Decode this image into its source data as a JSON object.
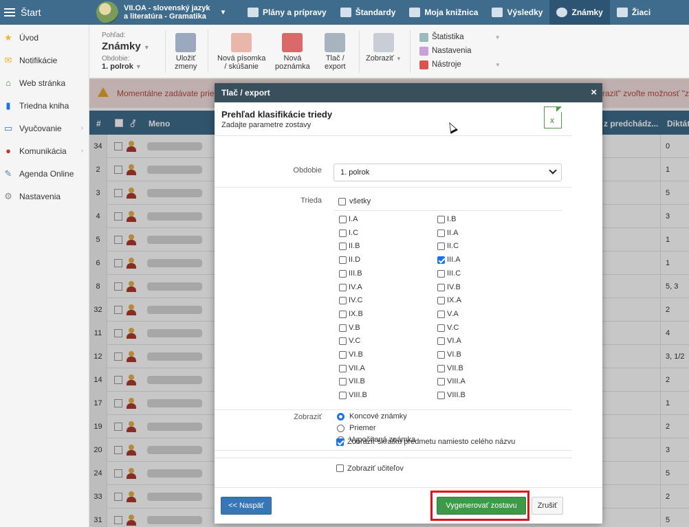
{
  "topbar": {
    "start_label": "Štart",
    "subject_line1": "VII.OA - slovenský jazyk",
    "subject_line2": "a literatúra - Gramatika",
    "nav": [
      {
        "label": "Plány a prípravy",
        "icon": "briefcase-icon"
      },
      {
        "label": "Štandardy",
        "icon": "shield-icon"
      },
      {
        "label": "Moja knižnica",
        "icon": "library-icon"
      },
      {
        "label": "Výsledky",
        "icon": "bar-chart-icon"
      },
      {
        "label": "Známky",
        "icon": "grades-icon",
        "active": true
      },
      {
        "label": "Žiaci",
        "icon": "students-icon"
      }
    ]
  },
  "sidebar": {
    "items": [
      {
        "label": "Úvod",
        "icon": "star-icon",
        "color": "#f0b429"
      },
      {
        "label": "Notifikácie",
        "icon": "envelope-icon",
        "color": "#f0b429"
      },
      {
        "label": "Web stránka",
        "icon": "home-icon",
        "color": "#2e8b57"
      },
      {
        "label": "Triedna kniha",
        "icon": "book-icon",
        "color": "#1a73e8"
      },
      {
        "label": "Vyučovanie",
        "icon": "open-book-icon",
        "color": "#3a6ea5",
        "submenu": true
      },
      {
        "label": "Komunikácia",
        "icon": "chat-icon",
        "color": "#c0392b",
        "submenu": true
      },
      {
        "label": "Agenda Online",
        "icon": "pen-icon",
        "color": "#4a7fb5"
      },
      {
        "label": "Nastavenia",
        "icon": "gear-icon",
        "color": "#888888"
      }
    ]
  },
  "toolbar": {
    "view_label": "Pohľad:",
    "view_value": "Známky",
    "period_label": "Obdobie:",
    "period_value": "1. polrok",
    "save_line1": "Uložiť",
    "save_line2": "zmeny",
    "new_test_line1": "Nová písomka",
    "new_test_line2": "/ skúšanie",
    "new_note_line1": "Nová",
    "new_note_line2": "poznámka",
    "print_line1": "Tlač /",
    "print_line2": "export",
    "show_label": "Zobraziť",
    "statistics_label": "Štatistika",
    "settings_label": "Nastavenia",
    "tools_label": "Nástroje"
  },
  "warning": {
    "text_left": "Momentálne zadávate priebe",
    "text_right": "razit\" zvoľte možnosť \"zn"
  },
  "table": {
    "headers": {
      "num": "#",
      "name": "Meno",
      "prev": "z predchádz...",
      "dictation": "Diktát"
    },
    "rows": [
      {
        "num": "34",
        "val": "0"
      },
      {
        "num": "2",
        "val": "1"
      },
      {
        "num": "3",
        "val": "5"
      },
      {
        "num": "4",
        "val": "3"
      },
      {
        "num": "5",
        "val": "1"
      },
      {
        "num": "6",
        "val": "1"
      },
      {
        "num": "8",
        "val": "5,  3"
      },
      {
        "num": "32",
        "val": "2"
      },
      {
        "num": "11",
        "val": "4"
      },
      {
        "num": "12",
        "val": "3,  1/2"
      },
      {
        "num": "14",
        "val": "2"
      },
      {
        "num": "17",
        "val": "1"
      },
      {
        "num": "19",
        "val": "2"
      },
      {
        "num": "20",
        "val": "3"
      },
      {
        "num": "24",
        "val": "5"
      },
      {
        "num": "33",
        "val": "2"
      },
      {
        "num": "31",
        "val": "5"
      }
    ]
  },
  "modal": {
    "header_title": "Tlač / export",
    "close_symbol": "×",
    "title": "Prehľad klasifikácie triedy",
    "subtitle": "Zadajte parametre zostavy",
    "excel_symbol": "x",
    "period_label": "Obdobie",
    "period_value": "1. polrok",
    "class_label": "Trieda",
    "all_label": "všetky",
    "classes": [
      {
        "label": "I.A",
        "checked": false
      },
      {
        "label": "I.B",
        "checked": false
      },
      {
        "label": "I.C",
        "checked": false
      },
      {
        "label": "II.A",
        "checked": false
      },
      {
        "label": "II.B",
        "checked": false
      },
      {
        "label": "II.C",
        "checked": false
      },
      {
        "label": "II.D",
        "checked": false
      },
      {
        "label": "III.A",
        "checked": true
      },
      {
        "label": "III.B",
        "checked": false
      },
      {
        "label": "III.C",
        "checked": false
      },
      {
        "label": "IV.A",
        "checked": false
      },
      {
        "label": "IV.B",
        "checked": false
      },
      {
        "label": "IV.C",
        "checked": false
      },
      {
        "label": "IX.A",
        "checked": false
      },
      {
        "label": "IX.B",
        "checked": false
      },
      {
        "label": "V.A",
        "checked": false
      },
      {
        "label": "V.B",
        "checked": false
      },
      {
        "label": "V.C",
        "checked": false
      },
      {
        "label": "V.C",
        "checked": false
      },
      {
        "label": "VI.A",
        "checked": false
      },
      {
        "label": "VI.B",
        "checked": false
      },
      {
        "label": "VI.B",
        "checked": false
      },
      {
        "label": "VII.A",
        "checked": false
      },
      {
        "label": "VII.B",
        "checked": false
      },
      {
        "label": "VII.B",
        "checked": false
      },
      {
        "label": "VIII.A",
        "checked": false
      },
      {
        "label": "VIII.B",
        "checked": false
      },
      {
        "label": "VIII.B",
        "checked": false
      }
    ],
    "show_label": "Zobraziť",
    "show_options": [
      {
        "label": "Koncové známky",
        "selected": true
      },
      {
        "label": "Priemer",
        "selected": false
      },
      {
        "label": "Vypočítaná známka",
        "selected": false
      }
    ],
    "abbrev_label": "Zobraziť skratku predmetu namiesto celého názvu",
    "abbrev_checked": true,
    "teachers_label": "Zobraziť učiteľov",
    "teachers_checked": false,
    "back_label": "<< Naspäť",
    "generate_label": "Vygenerovať zostavu",
    "cancel_label": "Zrušiť"
  }
}
